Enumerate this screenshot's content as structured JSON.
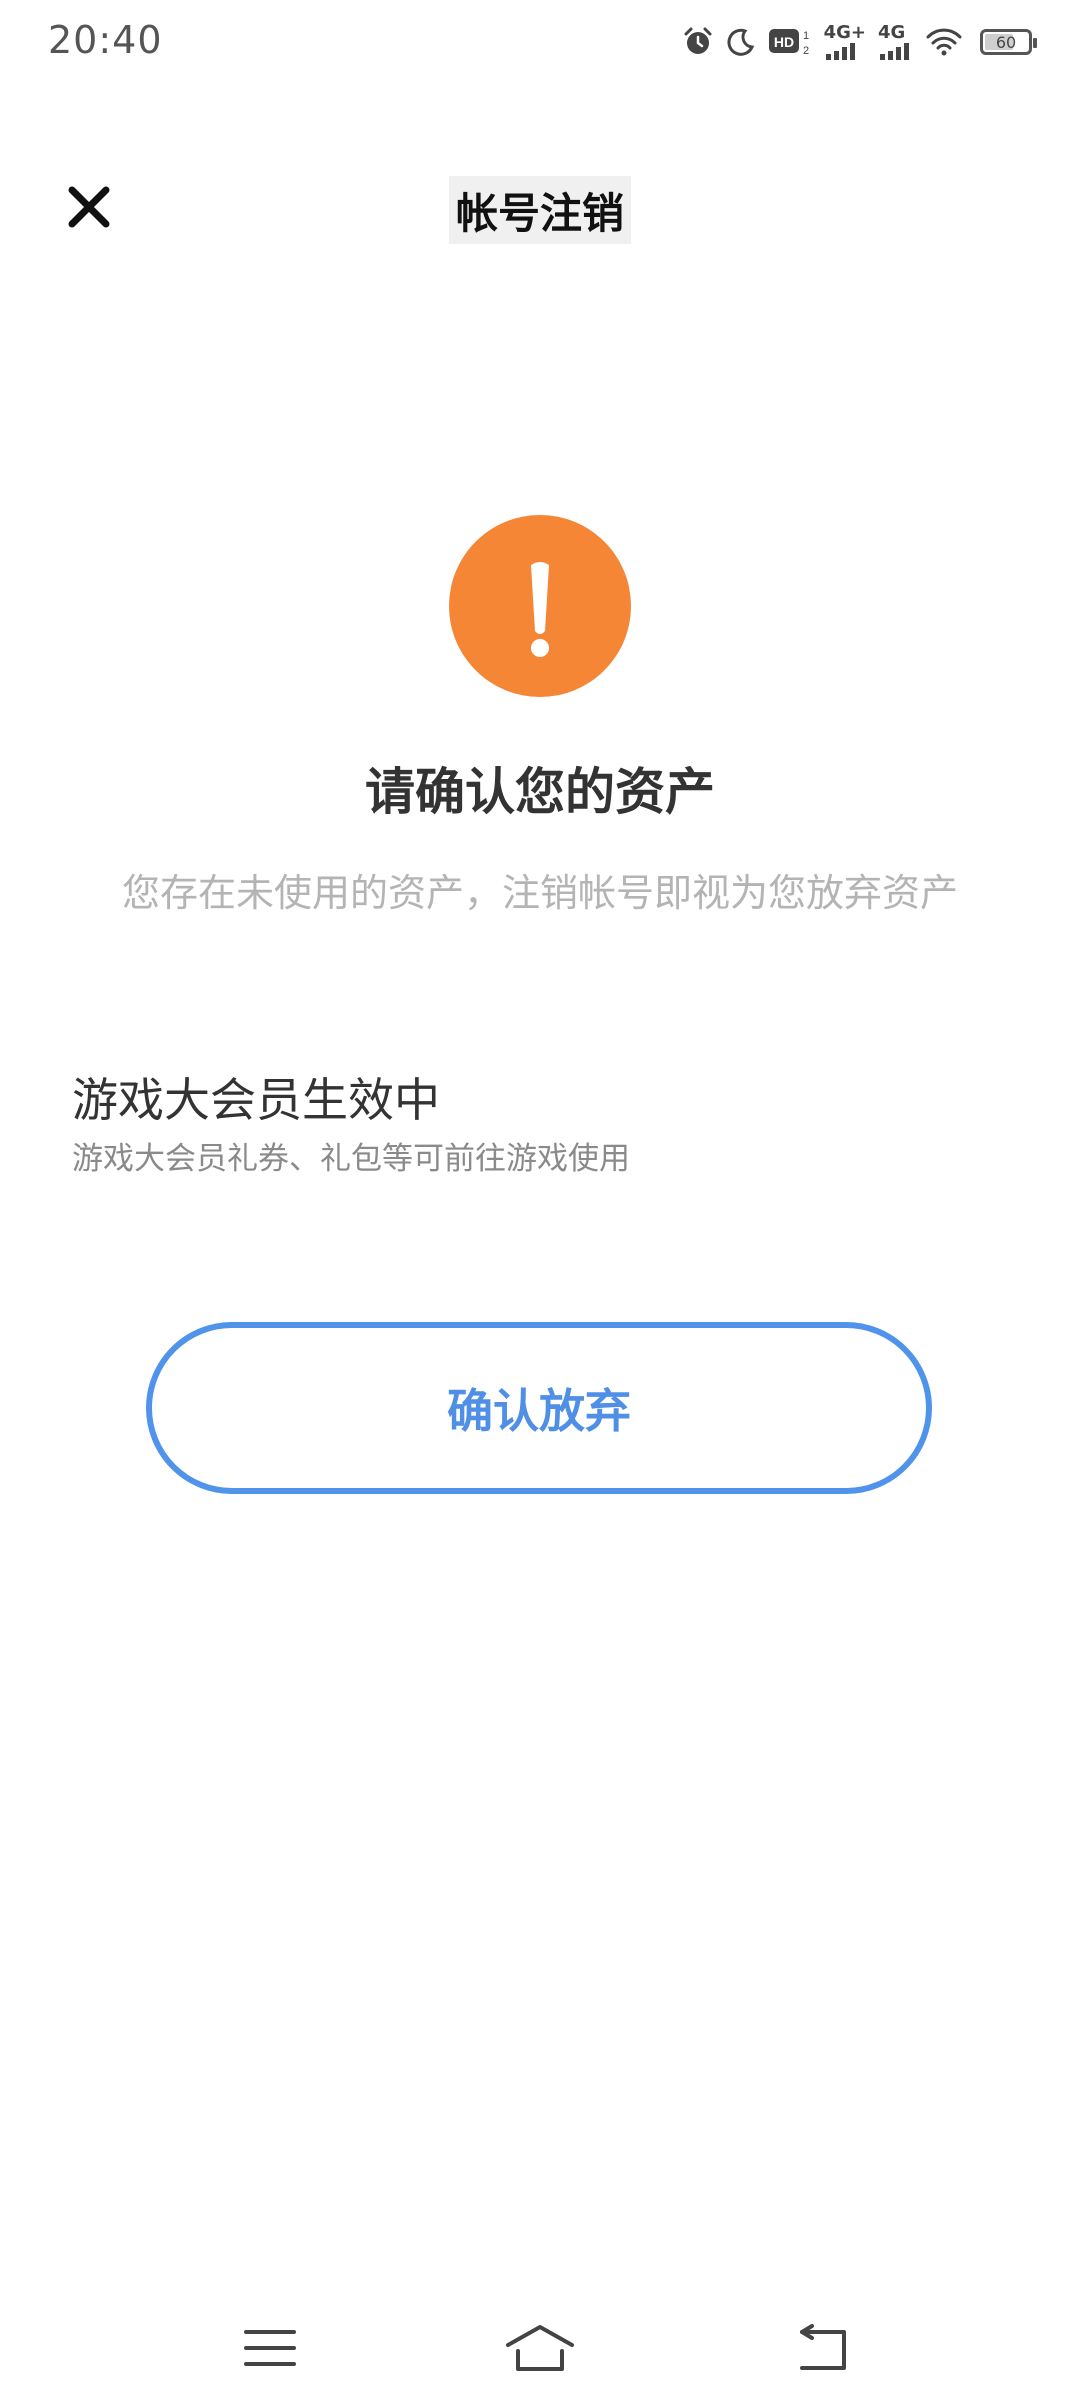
{
  "status_bar": {
    "time": "20:40",
    "network_1": "4G+",
    "network_2": "4G",
    "battery": "60"
  },
  "header": {
    "title": "帐号注销"
  },
  "warning": {
    "heading": "请确认您的资产",
    "subheading": "您存在未使用的资产，注销帐号即视为您放弃资产"
  },
  "asset": {
    "title": "游戏大会员生效中",
    "description": "游戏大会员礼券、礼包等可前往游戏使用"
  },
  "actions": {
    "confirm_label": "确认放弃"
  },
  "colors": {
    "warning": "#f58636",
    "accent": "#4f93ea"
  },
  "icons": {
    "close": "close-icon",
    "warning": "exclamation-icon",
    "menu": "menu-icon",
    "home": "home-icon",
    "back": "back-icon"
  }
}
